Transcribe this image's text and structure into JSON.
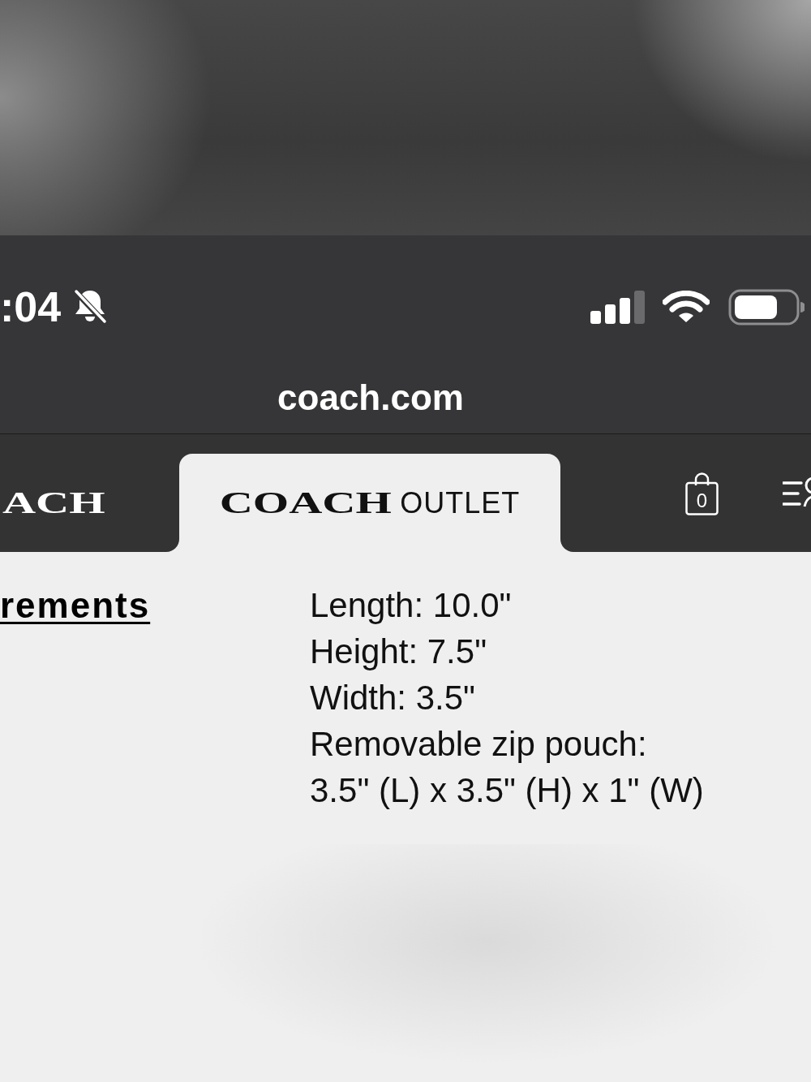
{
  "status_bar": {
    "time": ":04"
  },
  "address_bar": {
    "url": "coach.com"
  },
  "nav": {
    "tabs": [
      {
        "logo": "ACH",
        "selected": false
      },
      {
        "logo": "COACH",
        "suffix": "OUTLET",
        "selected": true
      }
    ],
    "bag_count": "0"
  },
  "details": {
    "heading": "rements",
    "lines": [
      "Length: 10.0\"",
      "Height: 7.5\"",
      "Width: 3.5\"",
      "Removable zip pouch:",
      "3.5\" (L) x 3.5\" (H) x 1\" (W)"
    ]
  }
}
